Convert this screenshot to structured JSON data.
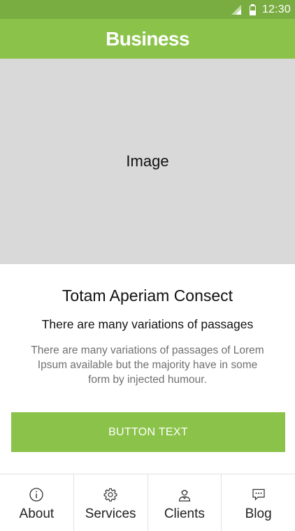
{
  "status_bar": {
    "time": "12:30",
    "icons": [
      "signal-icon",
      "battery-icon"
    ]
  },
  "app_bar": {
    "title": "Business"
  },
  "hero": {
    "placeholder_label": "Image"
  },
  "content": {
    "title": "Totam Aperiam Consect",
    "subtitle": "There are many variations of passages",
    "body": "There are many variations of passages of Lorem Ipsum available but the majority have in some form by injected humour."
  },
  "cta": {
    "label": "BUTTON TEXT"
  },
  "bottom_nav": {
    "items": [
      {
        "label": "About",
        "icon": "info-icon"
      },
      {
        "label": "Services",
        "icon": "gear-icon"
      },
      {
        "label": "Clients",
        "icon": "person-icon"
      },
      {
        "label": "Blog",
        "icon": "chat-bubble-icon"
      }
    ]
  },
  "colors": {
    "primary": "#8bc34a",
    "status_bar": "#79ad42",
    "hero_bg": "#d9d9d9",
    "body_text": "#707070"
  }
}
